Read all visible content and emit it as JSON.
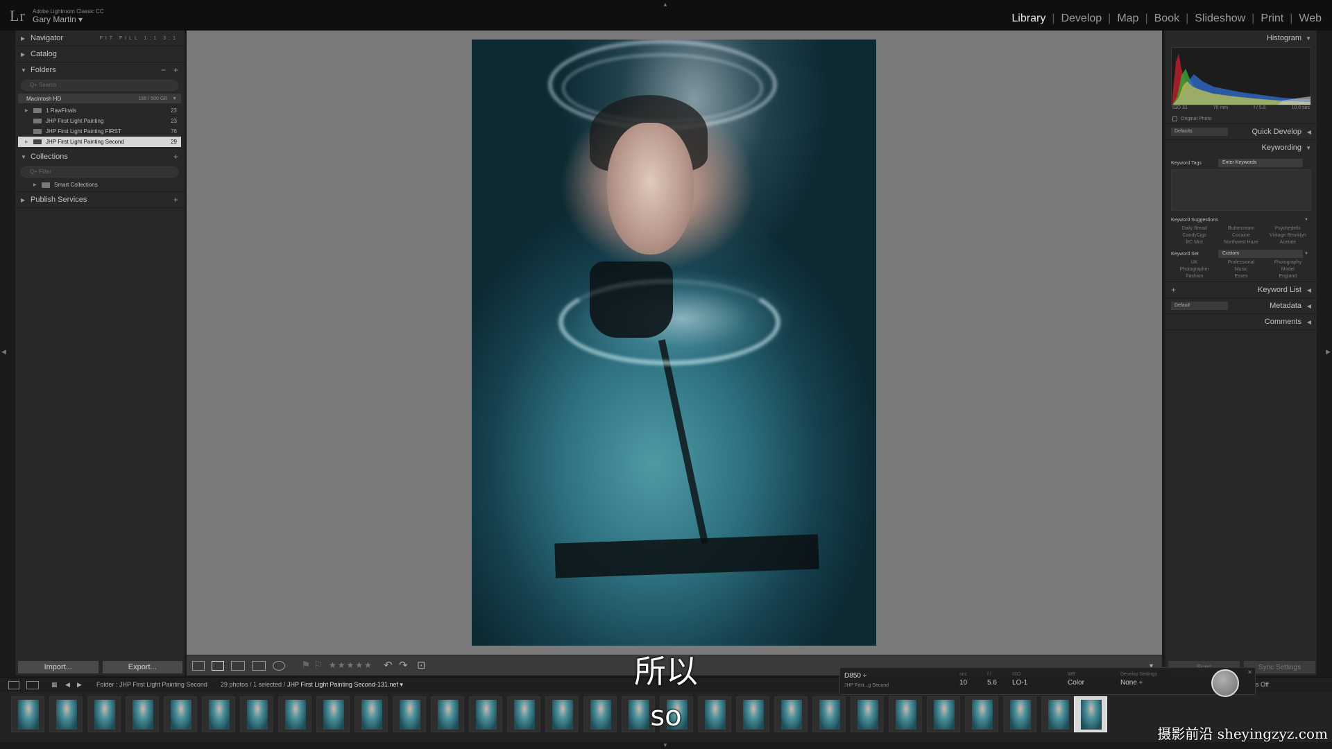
{
  "app": {
    "logo": "Lr",
    "name": "Adobe Lightroom Classic CC",
    "user": "Gary Martin ▾"
  },
  "modules": [
    "Library",
    "Develop",
    "Map",
    "Book",
    "Slideshow",
    "Print",
    "Web"
  ],
  "active_module": "Library",
  "left_panel": {
    "navigator": {
      "label": "Navigator",
      "zoom": "FIT   FILL   1:1   3:1"
    },
    "catalog": {
      "label": "Catalog"
    },
    "folders": {
      "label": "Folders",
      "search_placeholder": "Q+ Search",
      "volume": {
        "name": "Macintosh HD",
        "size": "168 / 500 GB"
      },
      "items": [
        {
          "name": "1 RawFinals",
          "count": "23"
        },
        {
          "name": "JHP First Light Painting",
          "count": "23"
        },
        {
          "name": "JHP First Light Painting FIRST",
          "count": "76"
        },
        {
          "name": "JHP First Light Painting Second",
          "count": "29"
        }
      ]
    },
    "collections": {
      "label": "Collections",
      "search_placeholder": "Q+ Filter",
      "items": [
        {
          "name": "Smart Collections"
        }
      ]
    },
    "publish": {
      "label": "Publish Services"
    },
    "import_label": "Import...",
    "export_label": "Export..."
  },
  "right_panel": {
    "histogram": {
      "label": "Histogram",
      "iso": "ISO 31",
      "focal": "70 mm",
      "aperture": "f / 5.6",
      "shutter": "10.0 sec",
      "original_photo": "Original Photo"
    },
    "quick_develop": {
      "label": "Quick Develop",
      "preset": "Defaults"
    },
    "keywording": {
      "label": "Keywording",
      "tags_label": "Keyword Tags",
      "tags_value": "Enter Keywords",
      "suggestions_label": "Keyword Suggestions",
      "suggestions": [
        "Daily Bread",
        "Buttercream",
        "Psychedelic",
        "CandyCigs",
        "Cocaine",
        "Vintage Brooklyn",
        "BC Mist",
        "Northwest Haze",
        "Acetate"
      ],
      "set_label": "Keyword Set",
      "set_value": "Custom",
      "set_items": [
        "UK",
        "Professional",
        "Photography",
        "Photographer",
        "Music",
        "Model",
        "Fashion",
        "Essex",
        "England"
      ]
    },
    "keyword_list": {
      "label": "Keyword List"
    },
    "metadata": {
      "label": "Metadata",
      "preset": "Default"
    },
    "comments": {
      "label": "Comments"
    },
    "sync_label": "Sync",
    "sync_settings_label": "Sync Settings"
  },
  "filmstrip": {
    "source": "Folder : JHP First Light Painting Second",
    "count": "29 photos / 1 selected /",
    "selected_file": "JHP First Light Painting Second-131.nef ▾",
    "sync_off": "s Off"
  },
  "overlay": {
    "camera": "D850 ÷",
    "folder": "JHP First...g Second",
    "sec_label": "sec",
    "sec_value": "10",
    "f_label": "f /",
    "f_value": "5.6",
    "iso_label": "ISO",
    "iso_value": "LO-1",
    "wb_label": "WB",
    "wb_value": "Color",
    "dev_label": "Develop Settings",
    "dev_value": "None ÷"
  },
  "subtitles": {
    "chinese": "所以",
    "english": "so"
  },
  "watermark": "摄影前沿 sheyingzyz.com",
  "colors": {
    "background": "#1a1a1a",
    "panel": "#282828",
    "canvas": "#7a7a7a",
    "selected_row": "#d6d6d6"
  }
}
